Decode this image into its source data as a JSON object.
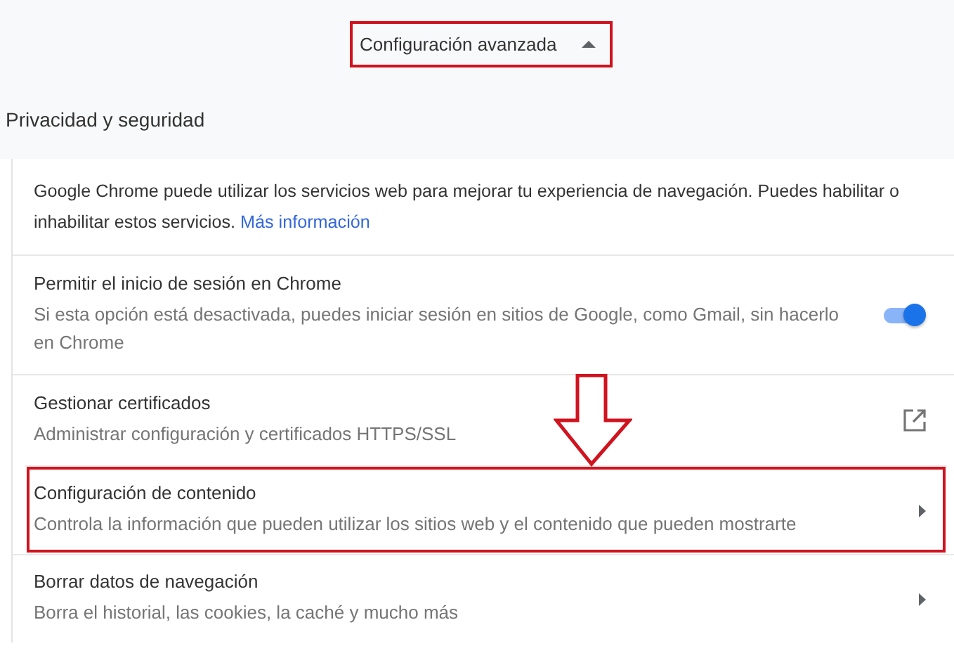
{
  "advanced_header": {
    "label": "Configuración avanzada",
    "expanded": true,
    "highlighted": true
  },
  "section": {
    "title": "Privacidad y seguridad",
    "rows": [
      {
        "kind": "info",
        "text": "Google Chrome puede utilizar los servicios web para mejorar tu experiencia de navegación. Puedes habilitar o inhabilitar estos servicios.",
        "link": "Más información"
      },
      {
        "kind": "toggle",
        "title": "Permitir el inicio de sesión en Chrome",
        "subtitle": "Si esta opción está desactivada, puedes iniciar sesión en sitios de Google, como Gmail, sin hacerlo en Chrome",
        "on": true
      },
      {
        "kind": "external",
        "title": "Gestionar certificados",
        "subtitle": "Administrar configuración y certificados HTTPS/SSL"
      },
      {
        "kind": "submenu",
        "title": "Configuración de contenido",
        "subtitle": "Controla la información que pueden utilizar los sitios web y el contenido que pueden mostrarte",
        "highlighted": true
      },
      {
        "kind": "submenu",
        "title": "Borrar datos de navegación",
        "subtitle": "Borra el historial, las cookies, la caché y mucho más",
        "highlighted": false
      }
    ],
    "pointer_arrow": true
  }
}
